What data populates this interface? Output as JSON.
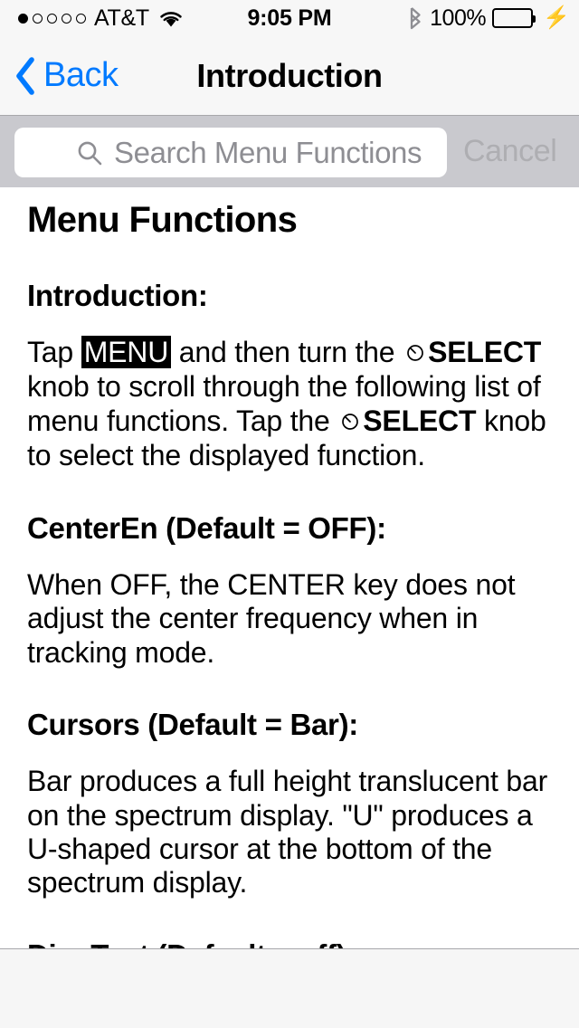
{
  "status_bar": {
    "carrier": "AT&T",
    "signal_dots_total": 5,
    "signal_dots_filled": 1,
    "wifi_icon": "wifi-icon",
    "time": "9:05 PM",
    "bluetooth_icon": "bluetooth-icon",
    "battery_percent": "100%",
    "battery_level": 100,
    "battery_color": "#4CD964",
    "charging_icon": "lightning-bolt-icon"
  },
  "nav_bar": {
    "back_label": "Back",
    "back_icon": "chevron-left-icon",
    "title": "Introduction",
    "accent_color": "#007AFF"
  },
  "search": {
    "placeholder": "Search Menu Functions",
    "value": "",
    "search_icon": "search-icon",
    "cancel_label": "Cancel",
    "cancel_enabled": false
  },
  "content": {
    "doc_title": "Menu Functions",
    "sections": [
      {
        "heading": "Introduction:",
        "paragraph_parts": [
          {
            "type": "text",
            "text": "Tap "
          },
          {
            "type": "inverse",
            "text": "MENU"
          },
          {
            "type": "text",
            "text": " and then turn the "
          },
          {
            "type": "knob-icon"
          },
          {
            "type": "bold",
            "text": "SELECT"
          },
          {
            "type": "text",
            "text": " knob to scroll through the following list of menu functions. Tap the "
          },
          {
            "type": "knob-icon"
          },
          {
            "type": "bold",
            "text": "SELECT"
          },
          {
            "type": "text",
            "text": " knob to select the displayed function."
          }
        ]
      },
      {
        "heading": "CenterEn (Default = OFF):",
        "paragraph": "When OFF, the CENTER key does not adjust the center frequency when in tracking mode."
      },
      {
        "heading": "Cursors (Default = Bar):",
        "paragraph": "Bar produces a full height translucent bar on the spectrum display. \"U\" produces a U-shaped cursor at the bottom of the spectrum display."
      },
      {
        "heading": "DispTest (Default = off):",
        "paragraph": ""
      }
    ]
  }
}
